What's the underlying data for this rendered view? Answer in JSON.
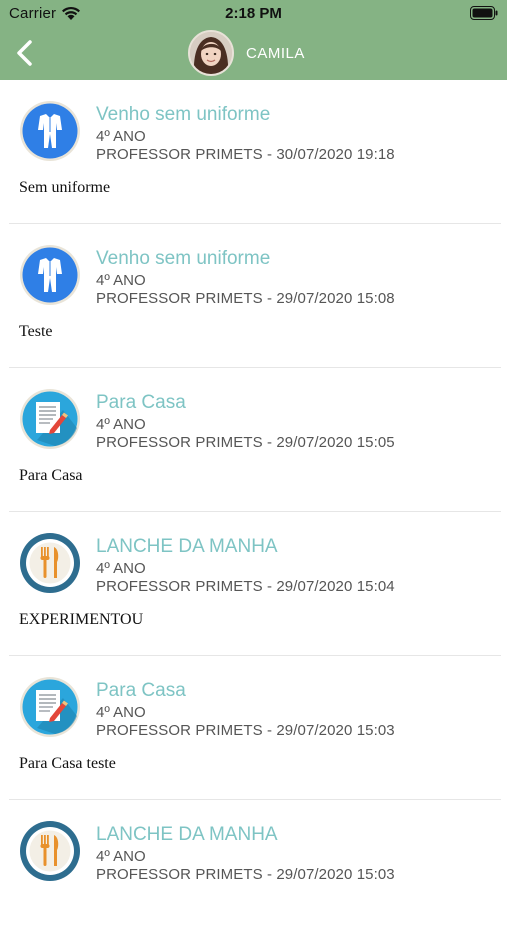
{
  "status_bar": {
    "carrier": "Carrier",
    "time": "2:18 PM"
  },
  "header": {
    "child_name": "CAMILA",
    "background_color": "#85b384"
  },
  "colors": {
    "title": "#7ec4c4",
    "uniform_icon_bg": "#2f7fe6",
    "homework_icon_bg": "#2ba6dc",
    "lunch_icon_bg": "#2e6d8f"
  },
  "items": [
    {
      "icon": "uniform-icon",
      "title": "Venho sem uniforme",
      "grade": "4º ANO",
      "meta": "PROFESSOR PRIMETS - 30/07/2020 19:18",
      "message": "Sem uniforme"
    },
    {
      "icon": "uniform-icon",
      "title": "Venho sem uniforme",
      "grade": "4º ANO",
      "meta": "PROFESSOR PRIMETS - 29/07/2020 15:08",
      "message": "Teste"
    },
    {
      "icon": "homework-icon",
      "title": "Para Casa",
      "grade": "4º ANO",
      "meta": "PROFESSOR PRIMETS - 29/07/2020 15:05",
      "message": "Para Casa"
    },
    {
      "icon": "lunch-icon",
      "title": "LANCHE DA MANHA",
      "grade": "4º ANO",
      "meta": "PROFESSOR PRIMETS - 29/07/2020 15:04",
      "message": "EXPERIMENTOU"
    },
    {
      "icon": "homework-icon",
      "title": "Para Casa",
      "grade": "4º ANO",
      "meta": "PROFESSOR PRIMETS - 29/07/2020 15:03",
      "message": "Para Casa teste"
    },
    {
      "icon": "lunch-icon",
      "title": "LANCHE DA MANHA",
      "grade": "4º ANO",
      "meta": "PROFESSOR PRIMETS - 29/07/2020 15:03",
      "message": ""
    }
  ]
}
